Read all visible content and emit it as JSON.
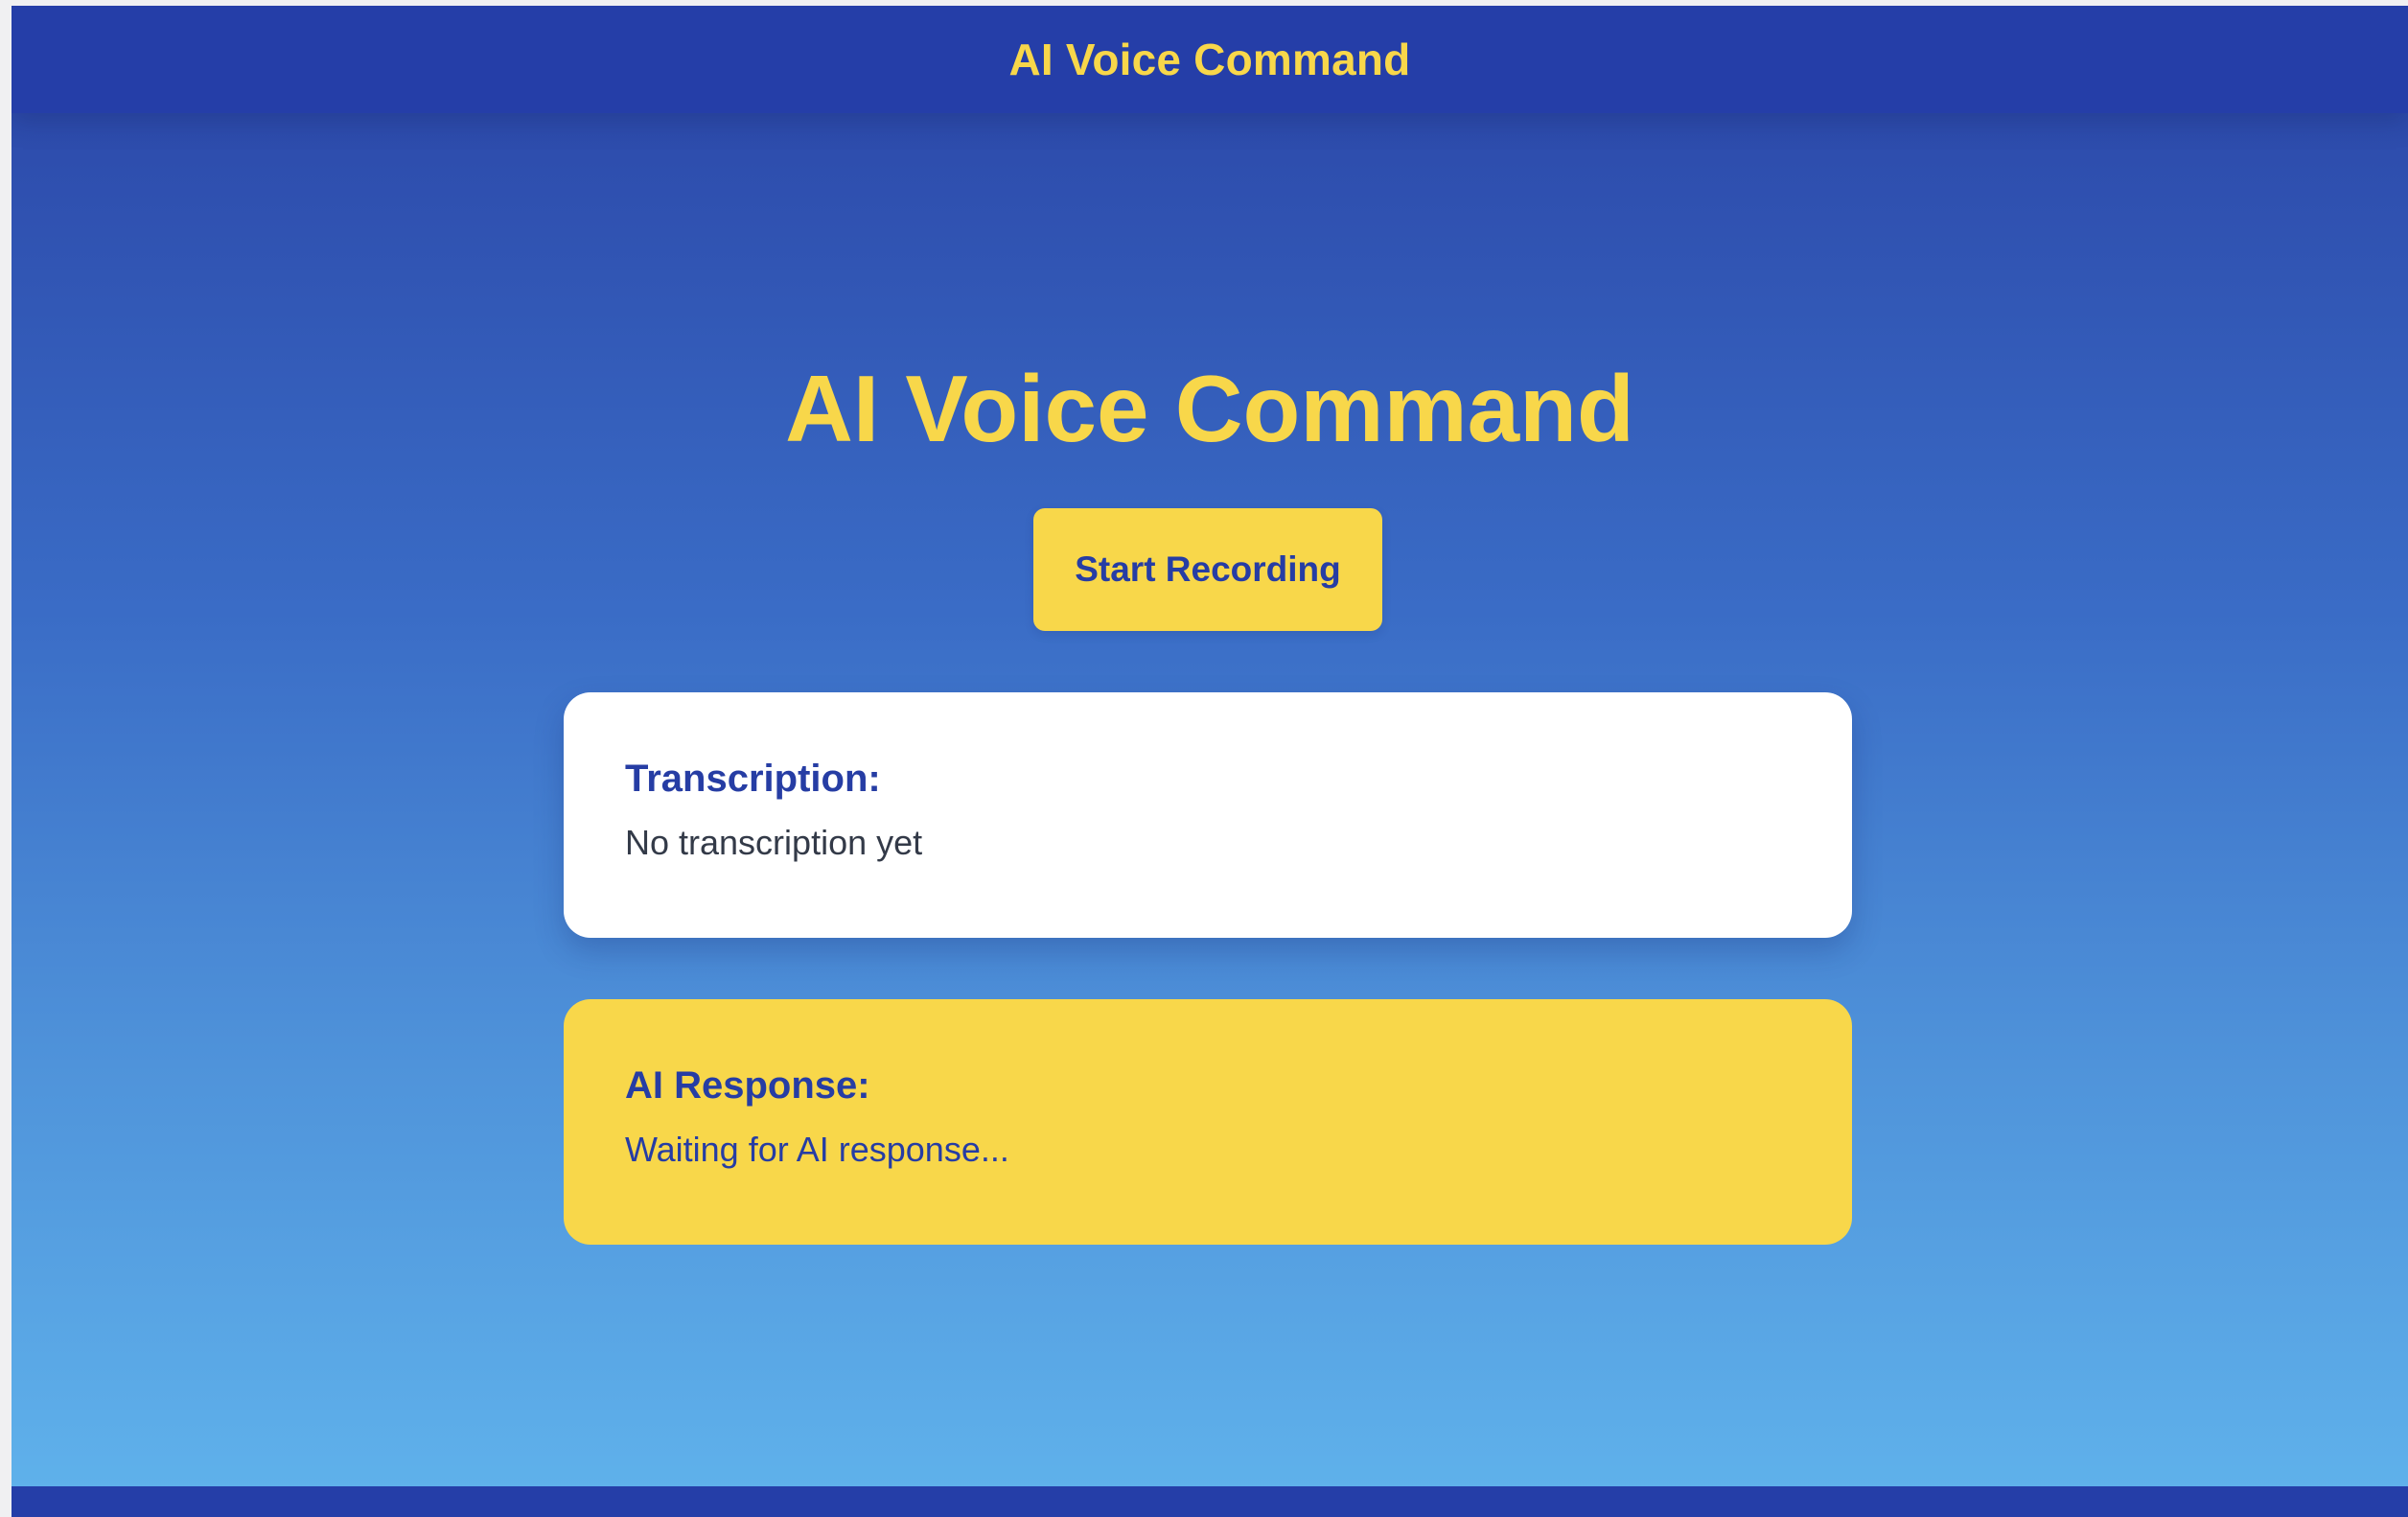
{
  "header": {
    "title": "AI Voice Command"
  },
  "main": {
    "title": "AI Voice Command",
    "record_button_label": "Start Recording"
  },
  "transcription": {
    "heading": "Transcription:",
    "text": "No transcription yet"
  },
  "response": {
    "heading": "AI Response:",
    "text": "Waiting for AI response..."
  },
  "colors": {
    "header_background": "#253ea8",
    "accent_yellow": "#f8d74a",
    "gradient_top": "#2a44a6",
    "gradient_bottom": "#60b3ec",
    "card_white": "#ffffff"
  }
}
